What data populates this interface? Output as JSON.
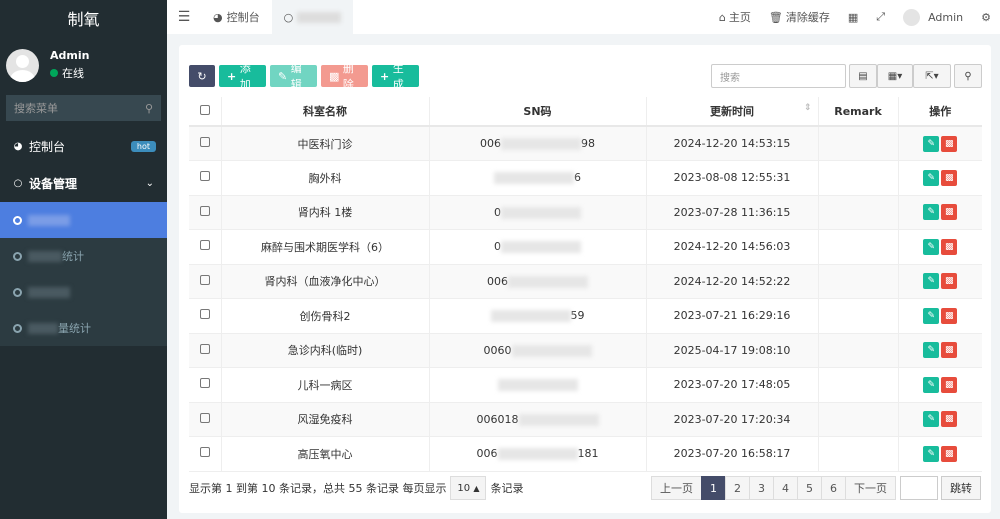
{
  "sidebar": {
    "brand": "制氧",
    "user_name": "Admin",
    "user_status": "在线",
    "search_placeholder": "搜索菜单",
    "dashboard_label": "控制台",
    "dashboard_badge": "hot",
    "group_label": "设备管理",
    "sub_items": [
      "",
      "统计",
      "",
      "量统计"
    ]
  },
  "topbar": {
    "tab_dashboard": "控制台",
    "home": "主页",
    "clear_cache": "清除缓存",
    "admin": "Admin"
  },
  "toolbar": {
    "add": "添加",
    "edit": "编辑",
    "delete": "删除",
    "generate": "生成",
    "search_placeholder": "搜索"
  },
  "table": {
    "headers": [
      "科室名称",
      "SN码",
      "更新时间",
      "Remark",
      "操作"
    ],
    "rows": [
      {
        "name": "中医科门诊",
        "sn_left": "006",
        "sn_right": "98",
        "time": "2024-12-20 14:53:15"
      },
      {
        "name": "胸外科",
        "sn_left": "",
        "sn_right": "6",
        "time": "2023-08-08 12:55:31"
      },
      {
        "name": "肾内科 1楼",
        "sn_left": "0",
        "sn_right": "",
        "time": "2023-07-28 11:36:15"
      },
      {
        "name": "麻醉与围术期医学科（6）",
        "sn_left": "0",
        "sn_right": "",
        "time": "2024-12-20 14:56:03"
      },
      {
        "name": "肾内科（血液净化中心）",
        "sn_left": "006",
        "sn_right": "",
        "time": "2024-12-20 14:52:22"
      },
      {
        "name": "创伤骨科2",
        "sn_left": "",
        "sn_right": "59",
        "time": "2023-07-21 16:29:16"
      },
      {
        "name": "急诊内科(临时)",
        "sn_left": "0060",
        "sn_right": "",
        "time": "2025-04-17 19:08:10"
      },
      {
        "name": "儿科一病区",
        "sn_left": "",
        "sn_right": "",
        "time": "2023-07-20 17:48:05"
      },
      {
        "name": "风湿免疫科",
        "sn_left": "006018",
        "sn_right": "",
        "time": "2023-07-20 17:20:34"
      },
      {
        "name": "高压氧中心",
        "sn_left": "006",
        "sn_right": "181",
        "time": "2023-07-20 16:58:17"
      }
    ]
  },
  "footer": {
    "summary": "显示第 1 到第 10 条记录，总共 55 条记录 每页显示",
    "page_size": "10",
    "suffix": "条记录",
    "prev": "上一页",
    "next": "下一页",
    "pages": [
      "1",
      "2",
      "3",
      "4",
      "5",
      "6"
    ],
    "jump": "跳转"
  }
}
